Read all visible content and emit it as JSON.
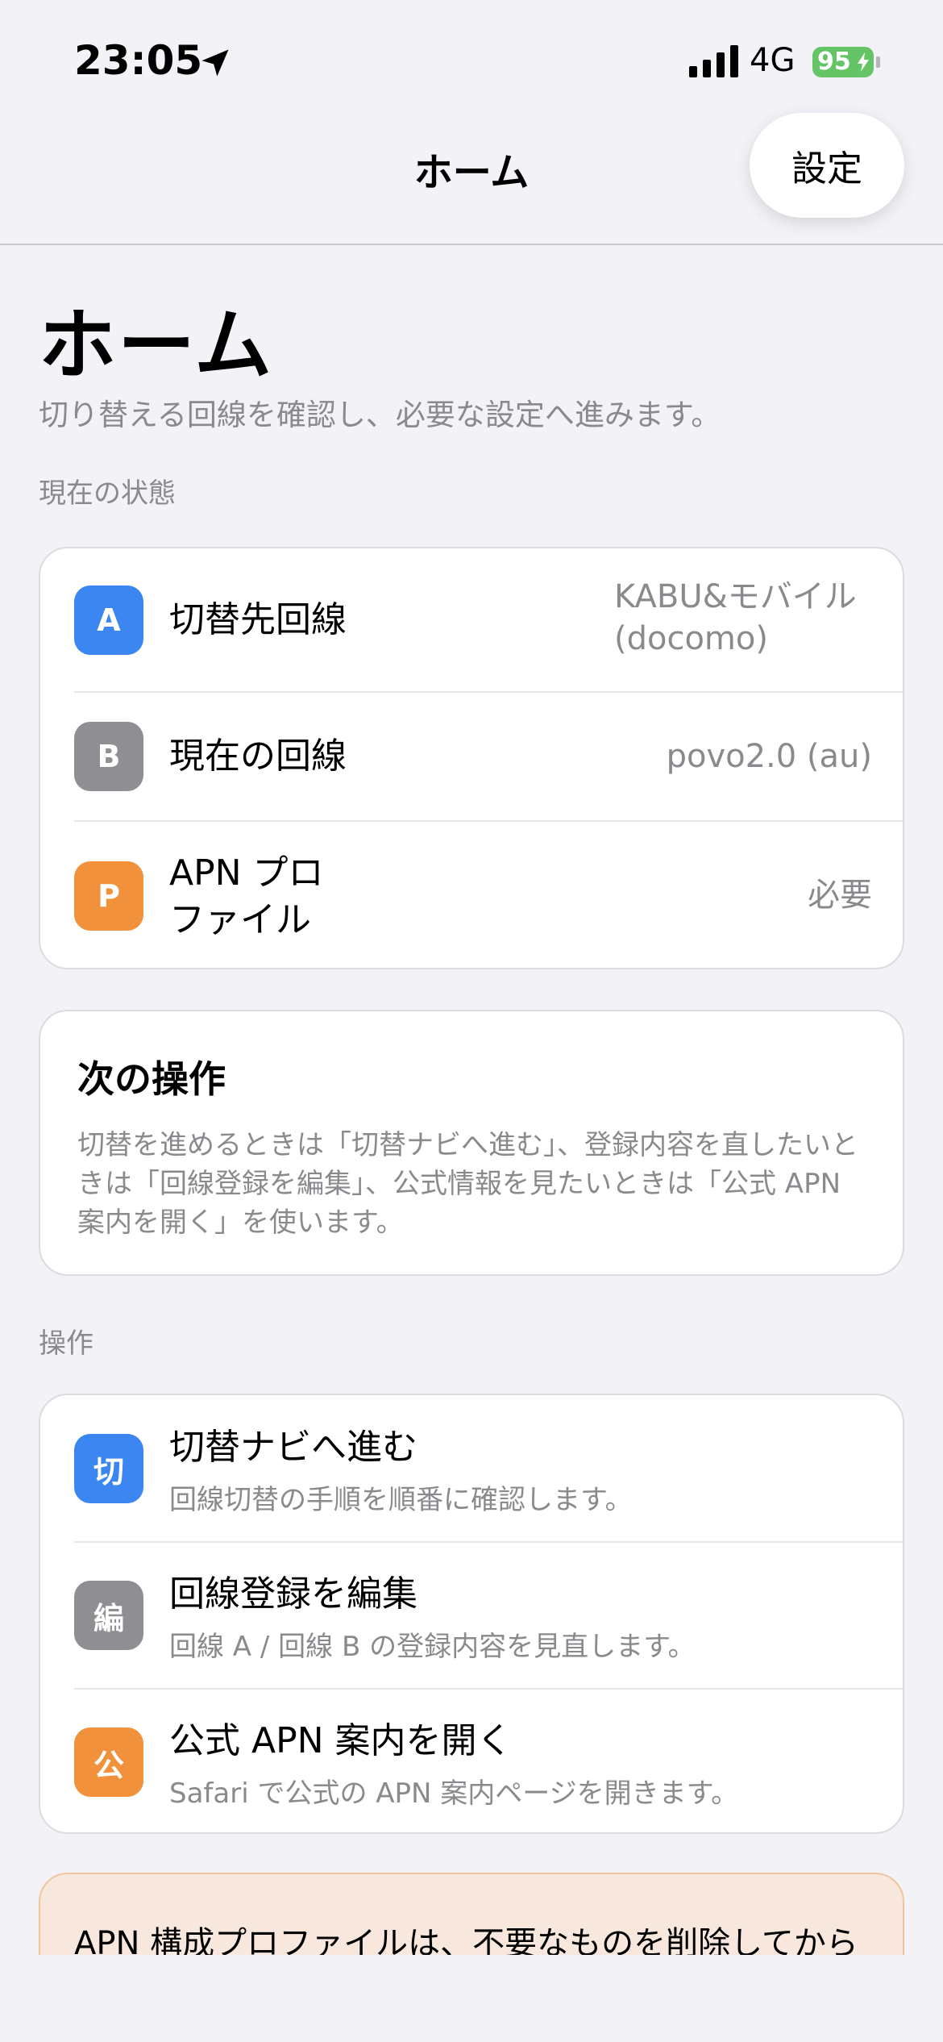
{
  "status_bar": {
    "time": "23:05",
    "network": "4G",
    "battery": "95",
    "icons": [
      "location-arrow-icon",
      "cellular-signal-icon",
      "battery-charging-icon"
    ]
  },
  "nav": {
    "title": "ホーム",
    "settings_label": "設定"
  },
  "page": {
    "title": "ホーム",
    "subtitle": "切り替える回線を確認し、必要な設定へ進みます。"
  },
  "status_section": {
    "label": "現在の状態",
    "rows": [
      {
        "badge": "A",
        "badge_color": "#3b86f0",
        "label": "切替先回線",
        "value_line1": "KABU&モバイル",
        "value_line2": "(docomo)"
      },
      {
        "badge": "B",
        "badge_color": "#8e8e93",
        "label": "現在の回線",
        "value_line1": "povo2.0 (au)"
      },
      {
        "badge": "P",
        "badge_color": "#f2913b",
        "label_line1": "APN プロ",
        "label_line2": "ファイル",
        "value_line1": "必要"
      }
    ]
  },
  "next_action": {
    "title": "次の操作",
    "body": "切替を進めるときは「切替ナビへ進む」、登録内容を直したいときは「回線登録を編集」、公式情報を見たいときは「公式 APN 案内を開く」を使います。"
  },
  "actions_section": {
    "label": "操作",
    "items": [
      {
        "badge": "切",
        "badge_color": "#3b86f0",
        "title": "切替ナビへ進む",
        "subtitle": "回線切替の手順を順番に確認します。"
      },
      {
        "badge": "編",
        "badge_color": "#8e8e93",
        "title": "回線登録を編集",
        "subtitle": "回線 A / 回線 B の登録内容を見直します。"
      },
      {
        "badge": "公",
        "badge_color": "#f2913b",
        "title": "公式 APN 案内を開く",
        "subtitle": "Safari で公式の APN 案内ページを開きます。"
      }
    ]
  },
  "warning": {
    "text": "APN 構成プロファイルは、不要なものを削除してから入れ直す必要がある場合があります。"
  }
}
